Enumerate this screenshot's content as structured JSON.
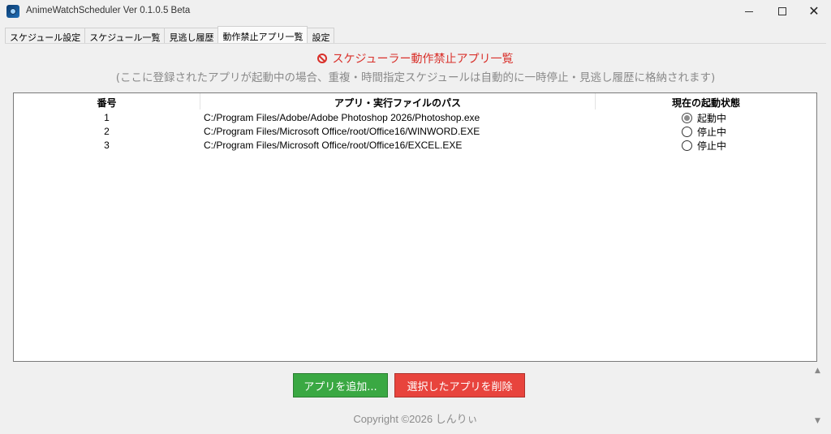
{
  "window": {
    "title": "AnimeWatchScheduler Ver 0.1.0.5 Beta",
    "minimize": "—",
    "maximize": "☐",
    "close": "✕"
  },
  "tabs": [
    {
      "label": "スケジュール設定"
    },
    {
      "label": "スケジュール一覧"
    },
    {
      "label": "見逃し履歴"
    },
    {
      "label": "動作禁止アプリ一覧"
    },
    {
      "label": "設定"
    }
  ],
  "active_tab": "動作禁止アプリ一覧",
  "page": {
    "heading": "スケジューラー動作禁止アプリ一覧",
    "heading_icon": "prohibited-icon",
    "subheading": "(ここに登録されたアプリが起動中の場合、重複・時間指定スケジュールは自動的に一時停止・見逃し履歴に格納されます)"
  },
  "table": {
    "columns": [
      "番号",
      "アプリ・実行ファイルのパス",
      "現在の起動状態"
    ],
    "rows": [
      {
        "num": "1",
        "path": "C:/Program Files/Adobe/Adobe Photoshop 2026/Photoshop.exe",
        "status": "起動中",
        "running": true
      },
      {
        "num": "2",
        "path": "C:/Program Files/Microsoft Office/root/Office16/WINWORD.EXE",
        "status": "停止中",
        "running": false
      },
      {
        "num": "3",
        "path": "C:/Program Files/Microsoft Office/root/Office16/EXCEL.EXE",
        "status": "停止中",
        "running": false
      }
    ]
  },
  "buttons": {
    "add": "アプリを追加...",
    "delete": "選択したアプリを削除"
  },
  "copyright": "Copyright ©2026 しんりぃ",
  "colors": {
    "heading": "#d9302a",
    "add_button": "#3aa843",
    "delete_button": "#e8443d"
  }
}
